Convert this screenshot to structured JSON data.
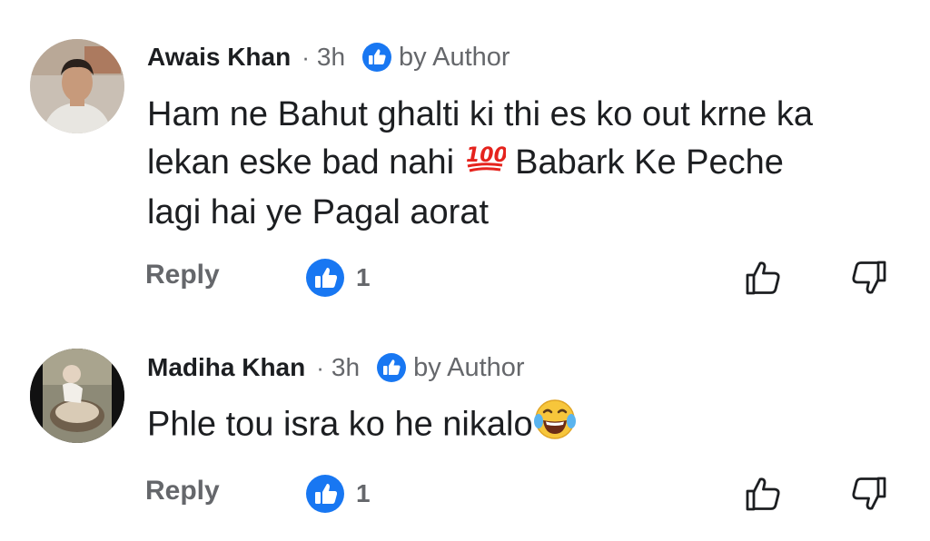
{
  "comments": [
    {
      "author": "Awais Khan",
      "separator": "·",
      "time": "3h",
      "badge_label": "by Author",
      "text_lines": [
        "Ham ne Bahut ghalti ki thi es ko out krne ka",
        "lekan eske bad nahi",
        "Babark Ke Peche",
        "lagi hai ye Pagal aorat"
      ],
      "reply_label": "Reply",
      "reaction_count": "1"
    },
    {
      "author": "Madiha Khan",
      "separator": "·",
      "time": "3h",
      "badge_label": "by Author",
      "text": "Phle tou isra ko he nikalo",
      "reply_label": "Reply",
      "reaction_count": "1"
    }
  ],
  "icons": {
    "badge": "thumbs-up-badge-icon",
    "hundred_emoji": "hundred-points-emoji",
    "laughing_emoji": "tears-of-joy-emoji",
    "reaction": "like-reaction-icon",
    "like": "thumbs-up-outline-icon",
    "dislike": "thumbs-down-outline-icon"
  },
  "colors": {
    "accent": "#1877f2",
    "secondary_text": "#65676b",
    "primary_text": "#1c1e21"
  }
}
